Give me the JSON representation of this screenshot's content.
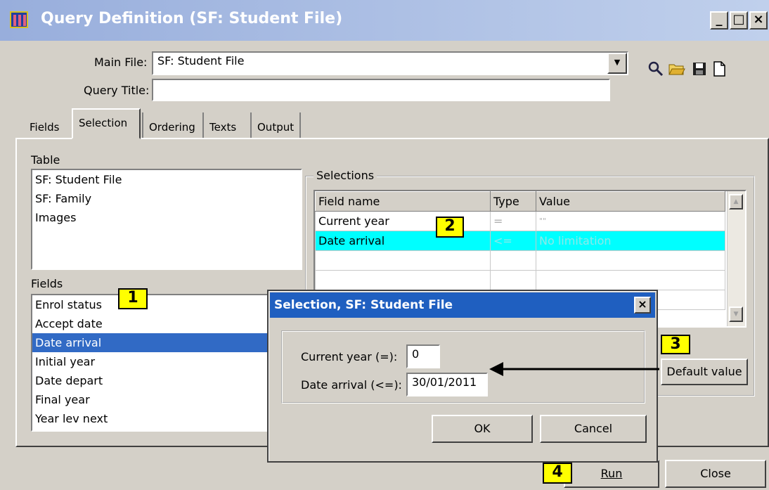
{
  "window": {
    "title": "Query Definition (SF: Student File)",
    "minimize": "_",
    "maximize": "□",
    "close": "×"
  },
  "header": {
    "main_file_label": "Main File:",
    "main_file_value": "SF: Student File",
    "query_title_label": "Query Title:",
    "query_title_value": "",
    "toolbar_icons": [
      "search-icon",
      "open-folder-icon",
      "save-icon",
      "new-document-icon"
    ]
  },
  "tabs": [
    {
      "label": "Fields"
    },
    {
      "label": "Selection"
    },
    {
      "label": "Ordering"
    },
    {
      "label": "Texts"
    },
    {
      "label": "Output"
    }
  ],
  "table_section": {
    "label": "Table",
    "items": [
      "SF: Student File",
      "SF: Family",
      "Images"
    ]
  },
  "fields_section": {
    "label": "Fields",
    "items": [
      "Enrol status",
      "Accept date",
      "Date arrival",
      "Initial year",
      "Date depart",
      "Final year",
      "Year lev next"
    ],
    "selected_index": 2
  },
  "selections": {
    "label": "Selections",
    "columns": [
      "Field name",
      "Type",
      "Value"
    ],
    "rows": [
      {
        "field": "Current year",
        "type": "=",
        "value": "\"\"",
        "highlight": false
      },
      {
        "field": "Date arrival",
        "type": "<=",
        "value": "No limitation",
        "highlight": true
      }
    ]
  },
  "default_value_button": "Default value",
  "dialog": {
    "title": "Selection, SF: Student File",
    "close": "×",
    "rows": [
      {
        "label": "Current year (=):",
        "value": "0"
      },
      {
        "label": "Date arrival (<=):",
        "value": "30/01/2011"
      }
    ],
    "ok": "OK",
    "cancel": "Cancel"
  },
  "footer": {
    "run": "Run",
    "close": "Close"
  },
  "callouts": [
    "1",
    "2",
    "3",
    "4"
  ],
  "colors": {
    "title_gradient_start": "#98aedc",
    "dialog_title": "#1f5fc0",
    "selected_item": "#316ac5",
    "highlight_row": "#00ffff",
    "callout": "#ffff00"
  }
}
